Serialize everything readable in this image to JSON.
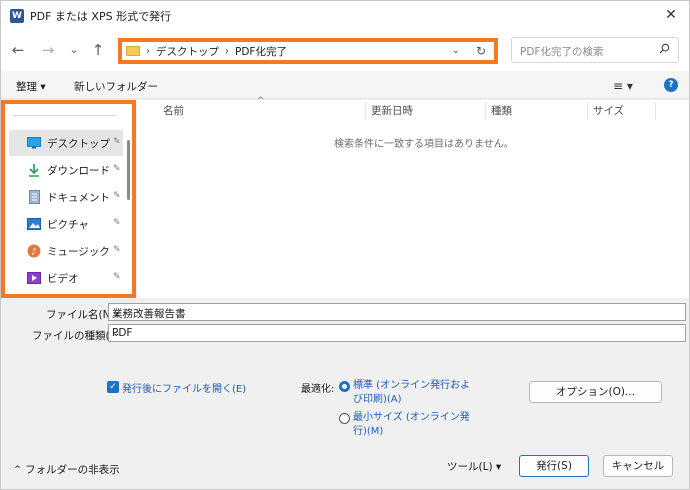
{
  "window": {
    "title": "PDF または XPS 形式で発行",
    "app_icon": "W",
    "close_symbol": "✕"
  },
  "nav": {
    "back": "←",
    "forward": "→",
    "recent": "⌄",
    "up": "↑",
    "breadcrumb_sep": "›",
    "breadcrumbs": [
      "デスクトップ",
      "PDF化完了"
    ],
    "search_placeholder": "PDF化完了の検索"
  },
  "toolbar": {
    "organize": "整理 ▾",
    "new_folder": "新しいフォルダー",
    "view_symbol": "≡ ▾",
    "help": "?"
  },
  "sidebar": {
    "items": [
      {
        "label": "デスクトップ",
        "icon": "desktop-icon",
        "selected": true
      },
      {
        "label": "ダウンロード",
        "icon": "download-icon"
      },
      {
        "label": "ドキュメント",
        "icon": "document-icon"
      },
      {
        "label": "ピクチャ",
        "icon": "pictures-icon"
      },
      {
        "label": "ミュージック",
        "icon": "music-icon"
      },
      {
        "label": "ビデオ",
        "icon": "video-icon"
      }
    ],
    "pin_symbol": "📌"
  },
  "filelist": {
    "columns": [
      "名前",
      "更新日時",
      "種類",
      "サイズ"
    ],
    "sort_caret": "^",
    "empty_message": "検索条件に一致する項目はありません。"
  },
  "form": {
    "filename_label": "ファイル名(N):",
    "filename_value": "業務改善報告書",
    "filetype_label": "ファイルの種類(T):",
    "filetype_value": "PDF",
    "chevron": "⌄"
  },
  "options": {
    "open_after_label": "発行後にファイルを開く(E)",
    "open_after_checked": true,
    "optimize_label": "最適化:",
    "standard_label": "標準 (オンライン発行および印刷)(A)",
    "minimum_label": "最小サイズ (オンライン発行)(M)",
    "options_button": "オプション(O)..."
  },
  "footer": {
    "hide_folders": "フォルダーの非表示",
    "tools": "ツール(L)",
    "tools_chevron": "▾",
    "publish": "発行(S)",
    "cancel": "キャンセル"
  },
  "colors": {
    "highlight": "#f47920",
    "accent": "#1a73c9"
  }
}
